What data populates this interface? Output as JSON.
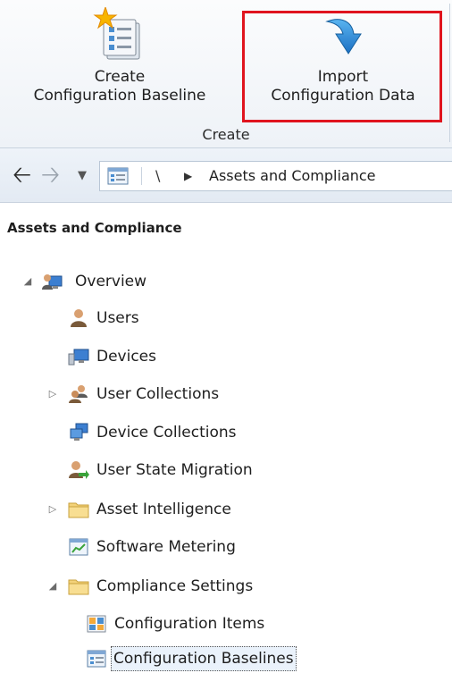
{
  "ribbon": {
    "buttons": [
      {
        "line1": "Create",
        "line2": "Configuration Baseline",
        "icon": "new-baseline-icon"
      },
      {
        "line1": "Import",
        "line2": "Configuration Data",
        "icon": "import-arrow-icon"
      }
    ],
    "group_label": "Create",
    "highlight_color": "#e0141e"
  },
  "address": {
    "separator": "\\",
    "crumb": "Assets and Compliance"
  },
  "tree": {
    "title": "Assets and Compliance",
    "items": [
      {
        "label": "Overview",
        "icon": "overview-icon"
      },
      {
        "label": "Users",
        "icon": "user-icon"
      },
      {
        "label": "Devices",
        "icon": "devices-icon"
      },
      {
        "label": "User Collections",
        "icon": "user-collections-icon"
      },
      {
        "label": "Device Collections",
        "icon": "device-collections-icon"
      },
      {
        "label": "User State Migration",
        "icon": "user-state-migration-icon"
      },
      {
        "label": "Asset Intelligence",
        "icon": "folder-icon"
      },
      {
        "label": "Software Metering",
        "icon": "software-metering-icon"
      },
      {
        "label": "Compliance Settings",
        "icon": "folder-icon"
      },
      {
        "label": "Configuration Items",
        "icon": "configuration-items-icon"
      },
      {
        "label": "Configuration Baselines",
        "icon": "configuration-baselines-icon"
      }
    ]
  }
}
